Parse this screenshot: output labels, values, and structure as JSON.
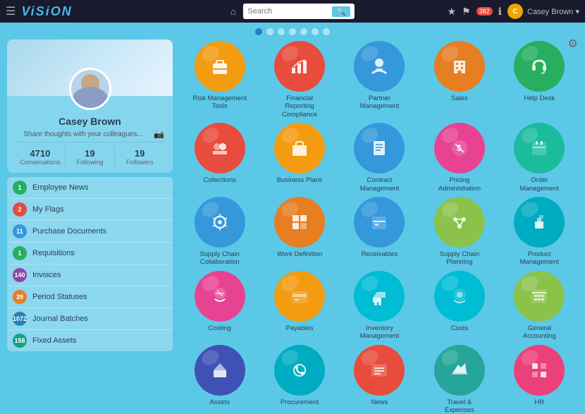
{
  "nav": {
    "logo": "ViSiON",
    "home_icon": "⌂",
    "search_placeholder": "Search",
    "badge_count": "382",
    "username": "Casey Brown ▾",
    "settings_icon": "⚙"
  },
  "dots": {
    "count": 7,
    "active_index": 0
  },
  "profile": {
    "name": "Casey Brown",
    "status_text": "Share thoughts with your colleagues...",
    "stats": [
      {
        "num": "4710",
        "label": "Conversations"
      },
      {
        "num": "19",
        "label": "Following"
      },
      {
        "num": "19",
        "label": "Followers"
      }
    ]
  },
  "nav_items": [
    {
      "label": "Employee News",
      "count": "1",
      "color": "#27ae60"
    },
    {
      "label": "My Flags",
      "count": "2",
      "color": "#e74c3c"
    },
    {
      "label": "Purchase Documents",
      "count": "11",
      "color": "#3498db"
    },
    {
      "label": "Requisitions",
      "count": "1",
      "color": "#27ae60"
    },
    {
      "label": "Invoices",
      "count": "140",
      "color": "#8e44ad"
    },
    {
      "label": "Period Statuses",
      "count": "39",
      "color": "#e67e22"
    },
    {
      "label": "Journal Batches",
      "count": "1072",
      "color": "#2980b9"
    },
    {
      "label": "Fixed Assets",
      "count": "158",
      "color": "#16a085"
    }
  ],
  "apps": [
    {
      "label": "Risk Management\nTools",
      "bg": "#f39c12",
      "icon": "briefcase"
    },
    {
      "label": "Financial Reporting\nCompliance",
      "bg": "#e74c3c",
      "icon": "chart"
    },
    {
      "label": "Partner\nManagement",
      "bg": "#3498db",
      "icon": "handshake"
    },
    {
      "label": "Sales",
      "bg": "#e67e22",
      "icon": "building"
    },
    {
      "label": "Help Desk",
      "bg": "#27ae60",
      "icon": "headset"
    },
    {
      "label": "Collections",
      "bg": "#e74c3c",
      "icon": "collections"
    },
    {
      "label": "Business Plans",
      "bg": "#f39c12",
      "icon": "briefcase2"
    },
    {
      "label": "Contract\nManagement",
      "bg": "#3498db",
      "icon": "contract"
    },
    {
      "label": "Pricing\nAdministration",
      "bg": "#e84393",
      "icon": "pricing"
    },
    {
      "label": "Order Management",
      "bg": "#1abc9c",
      "icon": "order"
    },
    {
      "label": "Supply Chain\nCollaboration",
      "bg": "#3498db",
      "icon": "supply"
    },
    {
      "label": "Work Definition",
      "bg": "#e67e22",
      "icon": "work"
    },
    {
      "label": "Receivables",
      "bg": "#3498db",
      "icon": "receivables"
    },
    {
      "label": "Supply Chain\nPlanning",
      "bg": "#8bc34a",
      "icon": "scplanning"
    },
    {
      "label": "Product\nManagement",
      "bg": "#00acc1",
      "icon": "product"
    },
    {
      "label": "Costing",
      "bg": "#e84393",
      "icon": "costing"
    },
    {
      "label": "Payables",
      "bg": "#f39c12",
      "icon": "payables"
    },
    {
      "label": "Inventory\nManagement",
      "bg": "#00bcd4",
      "icon": "inventory"
    },
    {
      "label": "Costs",
      "bg": "#00bcd4",
      "icon": "costs"
    },
    {
      "label": "General Accounting",
      "bg": "#8bc34a",
      "icon": "accounting"
    },
    {
      "label": "Assets",
      "bg": "#3f51b5",
      "icon": "assets"
    },
    {
      "label": "Procurement",
      "bg": "#00acc1",
      "icon": "procurement"
    },
    {
      "label": "News",
      "bg": "#e74c3c",
      "icon": "news"
    },
    {
      "label": "Travel &\nExpenses",
      "bg": "#26a69a",
      "icon": "travel"
    },
    {
      "label": "HR",
      "bg": "#ec407a",
      "icon": "hr"
    }
  ]
}
